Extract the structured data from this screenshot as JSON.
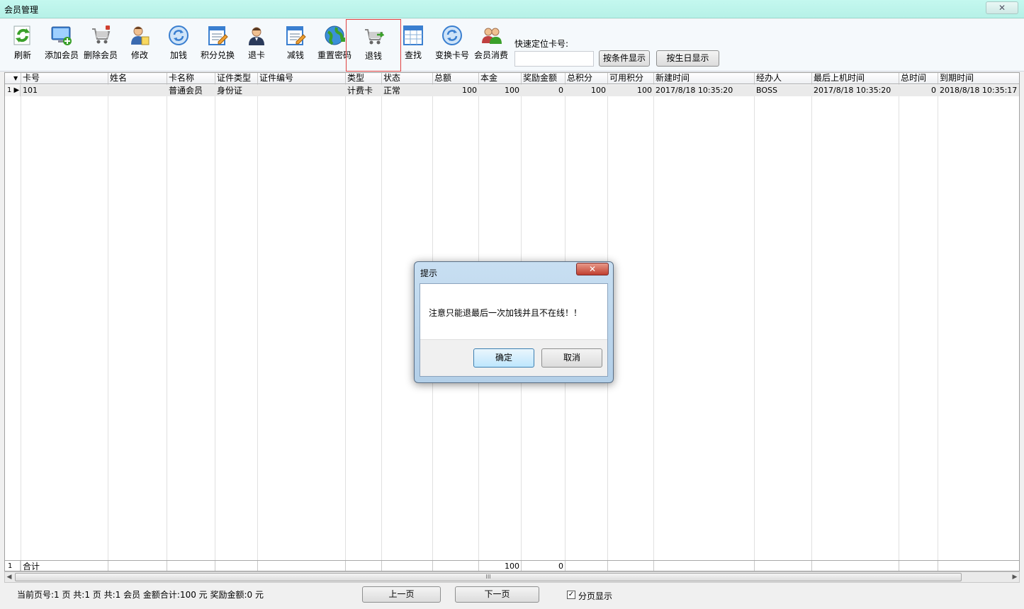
{
  "window": {
    "title": "会员管理",
    "close_glyph": "✕"
  },
  "toolbar": {
    "buttons": [
      {
        "label": "刷新",
        "icon": "refresh-icon"
      },
      {
        "label": "添加会员",
        "icon": "add-member-icon"
      },
      {
        "label": "删除会员",
        "icon": "delete-member-icon"
      },
      {
        "label": "修改",
        "icon": "edit-member-icon"
      },
      {
        "label": "加钱",
        "icon": "add-money-icon"
      },
      {
        "label": "积分兑换",
        "icon": "points-exchange-icon"
      },
      {
        "label": "退卡",
        "icon": "return-card-icon"
      },
      {
        "label": "减钱",
        "icon": "deduct-money-icon"
      },
      {
        "label": "重置密码",
        "icon": "reset-password-icon"
      },
      {
        "label": "退钱",
        "icon": "refund-icon"
      },
      {
        "label": "查找",
        "icon": "search-icon"
      },
      {
        "label": "变换卡号",
        "icon": "change-card-icon"
      },
      {
        "label": "会员消费",
        "icon": "member-consume-icon"
      }
    ],
    "selected": "退钱"
  },
  "quick_search": {
    "label": "快速定位卡号:",
    "value": "",
    "by_condition_label": "按条件显示",
    "by_birthday_label": "按生日显示"
  },
  "grid": {
    "columns": [
      "卡号",
      "姓名",
      "卡名称",
      "证件类型",
      "证件编号",
      "类型",
      "状态",
      "总额",
      "本金",
      "奖励金额",
      "总积分",
      "可用积分",
      "新建时间",
      "经办人",
      "最后上机时间",
      "总时间",
      "到期时间"
    ],
    "rows": [
      {
        "index": "1",
        "cells": [
          "101",
          "",
          "普通会员",
          "身份证",
          "",
          "计费卡",
          "正常",
          "100",
          "100",
          "0",
          "100",
          "100",
          "2017/8/18 10:35:20",
          "BOSS",
          "2017/8/18 10:35:20",
          "0",
          "2018/8/18 10:35:17"
        ]
      }
    ],
    "totals": {
      "index": "1",
      "label": "合计",
      "principal": "100",
      "bonus": "0"
    }
  },
  "scrollbar": {
    "left_arrow": "◀",
    "right_arrow": "▶",
    "grip": "III"
  },
  "status": {
    "info": "当前页号:1 页 共:1 页 共:1 会员 金额合计:100 元 奖励金额:0 元",
    "prev_label": "上一页",
    "next_label": "下一页",
    "paging_checked": true,
    "paging_label": "分页显示",
    "check_glyph": "✓"
  },
  "dialog": {
    "title": "提示",
    "close_glyph": "✕",
    "message": "注意只能退最后一次加钱并且不在线！！",
    "ok_label": "确定",
    "cancel_label": "取消"
  },
  "colors": {
    "titlebar": "#b6f1e7",
    "selected_border": "#e04040",
    "dialog_frame": "#b3cfe8",
    "close_button": "#c04030"
  }
}
